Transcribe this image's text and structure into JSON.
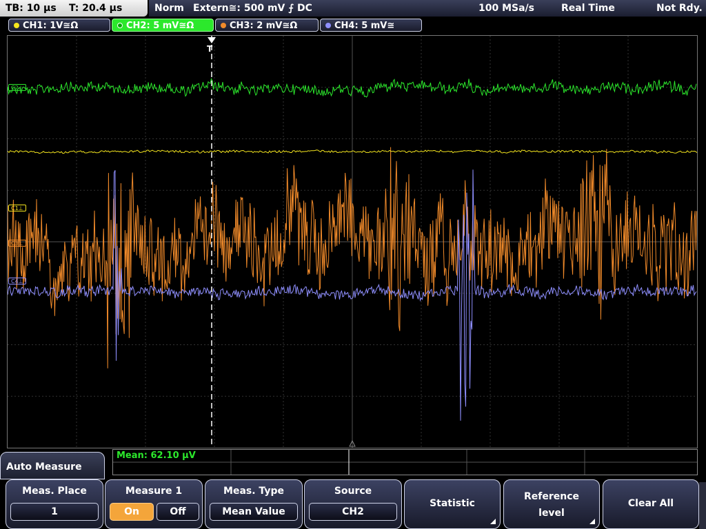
{
  "status": {
    "timebase": "TB: 10 µs",
    "trigger_time": "T: 20.4 µs",
    "trigger_mode": "Norm",
    "trigger_source": "Extern≅: 500 mV ⨍ DC",
    "sample_rate": "100 MSa/s",
    "acq_mode": "Real Time",
    "state": "Not Rdy."
  },
  "channels": [
    {
      "label": "CH1: 1V≅Ω",
      "color": "#f5e61e"
    },
    {
      "label": "CH2: 5 mV≅Ω",
      "color": "#2ce82c"
    },
    {
      "label": "CH3: 2 mV≅Ω",
      "color": "#f08a2a"
    },
    {
      "label": "CH4: 5 mV≅",
      "color": "#8f8fff"
    }
  ],
  "markers": {
    "ch2": "C2⊥",
    "ch1": "C1⊥",
    "ch3": "C3⊥",
    "ch4": "C4⊥",
    "trigger": "T"
  },
  "panel": {
    "title": "Auto Measure",
    "result": "Mean: 62.10 µV"
  },
  "softkeys": {
    "meas_place": {
      "title": "Meas. Place",
      "value": "1"
    },
    "measure": {
      "title": "Measure 1",
      "on": "On",
      "off": "Off"
    },
    "meas_type": {
      "title": "Meas. Type",
      "value": "Mean Value"
    },
    "source": {
      "title": "Source",
      "value": "CH2"
    },
    "statistic": {
      "label": "Statistic"
    },
    "reference": {
      "line1": "Reference",
      "line2": "level"
    },
    "clear_all": {
      "label": "Clear All"
    }
  }
}
